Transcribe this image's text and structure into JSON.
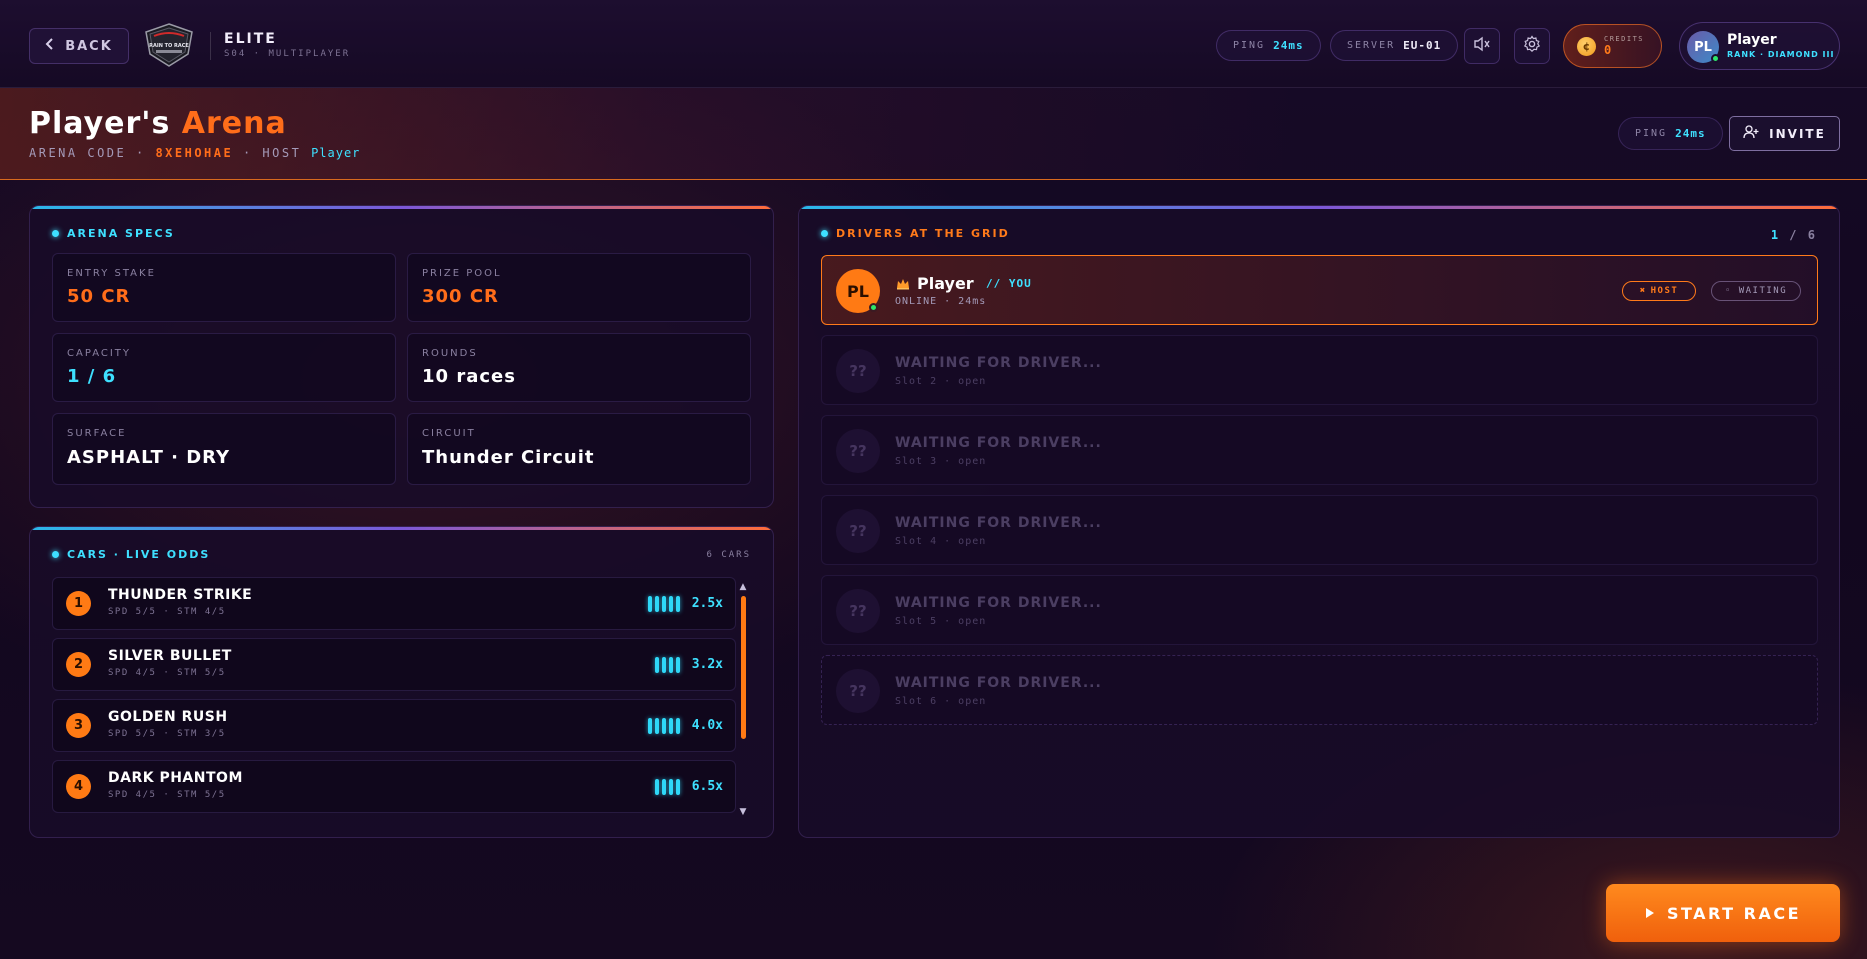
{
  "topbar": {
    "back_label": "BACK",
    "logo_text": "RAIN TO RACE",
    "brand_title": "ELITE",
    "brand_subtitle": "S04 · MULTIPLAYER",
    "ping_label": "PING",
    "ping_value": "24ms",
    "server_label": "SERVER",
    "server_value": "EU-01",
    "credits_label": "CREDITS",
    "credits_value": "0",
    "profile_initials": "PL",
    "profile_name": "Player",
    "profile_rank": "RANK · DIAMOND III"
  },
  "header": {
    "title_prefix": "Player's",
    "title_accent": "Arena",
    "code_label": "ARENA CODE ·",
    "code_value": "8XEHOHAE",
    "host_label": "· HOST",
    "host_value": "Player",
    "ping_label": "PING",
    "ping_value": "24ms",
    "invite_label": "INVITE"
  },
  "specs": {
    "heading": "ARENA SPECS",
    "items": [
      {
        "label": "ENTRY STAKE",
        "value": "50 CR"
      },
      {
        "label": "PRIZE POOL",
        "value": "300 CR"
      },
      {
        "label": "CAPACITY",
        "value": "1 / 6"
      },
      {
        "label": "ROUNDS",
        "value": "10 races"
      },
      {
        "label": "SURFACE",
        "value": "ASPHALT · DRY"
      },
      {
        "label": "CIRCUIT",
        "value": "Thunder Circuit"
      }
    ]
  },
  "cars": {
    "heading": "CARS · LIVE ODDS",
    "count": "6 CARS",
    "items": [
      {
        "rank": "1",
        "name": "THUNDER STRIKE",
        "stats": "SPD 5/5 · STM 4/5",
        "bars": 5,
        "odds": "2.5x"
      },
      {
        "rank": "2",
        "name": "SILVER BULLET",
        "stats": "SPD 4/5 · STM 5/5",
        "bars": 4,
        "odds": "3.2x"
      },
      {
        "rank": "3",
        "name": "GOLDEN RUSH",
        "stats": "SPD 5/5 · STM 3/5",
        "bars": 5,
        "odds": "4.0x"
      },
      {
        "rank": "4",
        "name": "DARK PHANTOM",
        "stats": "SPD 4/5 · STM 5/5",
        "bars": 4,
        "odds": "6.5x"
      }
    ]
  },
  "drivers": {
    "heading": "DRIVERS AT THE GRID",
    "count_current": "1",
    "count_sep": "/",
    "count_total": "6",
    "me": {
      "initials": "PL",
      "name": "Player",
      "you_tag": "// YOU",
      "status": "ONLINE · 24ms",
      "host_badge": "HOST",
      "wait_badge": "◦ WAITING"
    },
    "empty_slots": [
      {
        "title": "WAITING FOR DRIVER...",
        "sub": "Slot 2 · open"
      },
      {
        "title": "WAITING FOR DRIVER...",
        "sub": "Slot 3 · open"
      },
      {
        "title": "WAITING FOR DRIVER...",
        "sub": "Slot 4 · open"
      },
      {
        "title": "WAITING FOR DRIVER...",
        "sub": "Slot 5 · open"
      },
      {
        "title": "WAITING FOR DRIVER...",
        "sub": "Slot 6 · open"
      }
    ],
    "empty_avatar": "??"
  },
  "actions": {
    "start_label": "START RACE"
  },
  "colors": {
    "accent_orange": "#ff7a1a",
    "accent_cyan": "#3ee0ff",
    "online_green": "#2ee86a"
  },
  "icons": [
    "chevron-left-icon",
    "mute-icon",
    "gear-icon",
    "coin-icon",
    "add-user-icon",
    "crown-icon",
    "play-icon",
    "chevron-up-icon",
    "chevron-down-icon"
  ]
}
